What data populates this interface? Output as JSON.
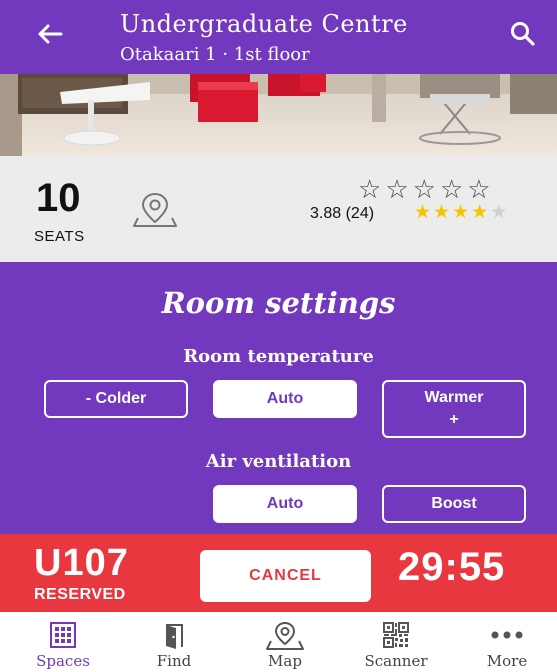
{
  "header": {
    "title": "Undergraduate Centre",
    "subtitle": "Otakaari 1 ·  1st floor"
  },
  "info": {
    "seats_count": "10",
    "seats_label": "SEATS",
    "rating_text": "3.88 (24)",
    "rating_value": 3.88,
    "rating_max": 5,
    "rate_prompt_stars": 5
  },
  "settings": {
    "title": "Room settings",
    "temperature": {
      "label": "Room temperature",
      "options": [
        "- Colder",
        "Auto",
        "Warmer +"
      ],
      "selected": "Auto"
    },
    "ventilation": {
      "label": "Air ventilation",
      "options": [
        "Auto",
        "Boost"
      ],
      "selected": "Auto"
    }
  },
  "reservation": {
    "room_code": "U107",
    "status": "RESERVED",
    "cancel_label": "CANCEL",
    "time_left": "29:55"
  },
  "nav": {
    "items": [
      {
        "label": "Spaces",
        "icon": "grid-icon",
        "active": true
      },
      {
        "label": "Find",
        "icon": "door-icon",
        "active": false
      },
      {
        "label": "Map",
        "icon": "map-pin-icon",
        "active": false
      },
      {
        "label": "Scanner",
        "icon": "qr-code-icon",
        "active": false
      },
      {
        "label": "More",
        "icon": "more-dots-icon",
        "active": false
      }
    ]
  },
  "colors": {
    "primary_purple": "#7238be",
    "reservation_red": "#e8373f",
    "star_yellow": "#f5c400",
    "info_background": "#ececec"
  }
}
